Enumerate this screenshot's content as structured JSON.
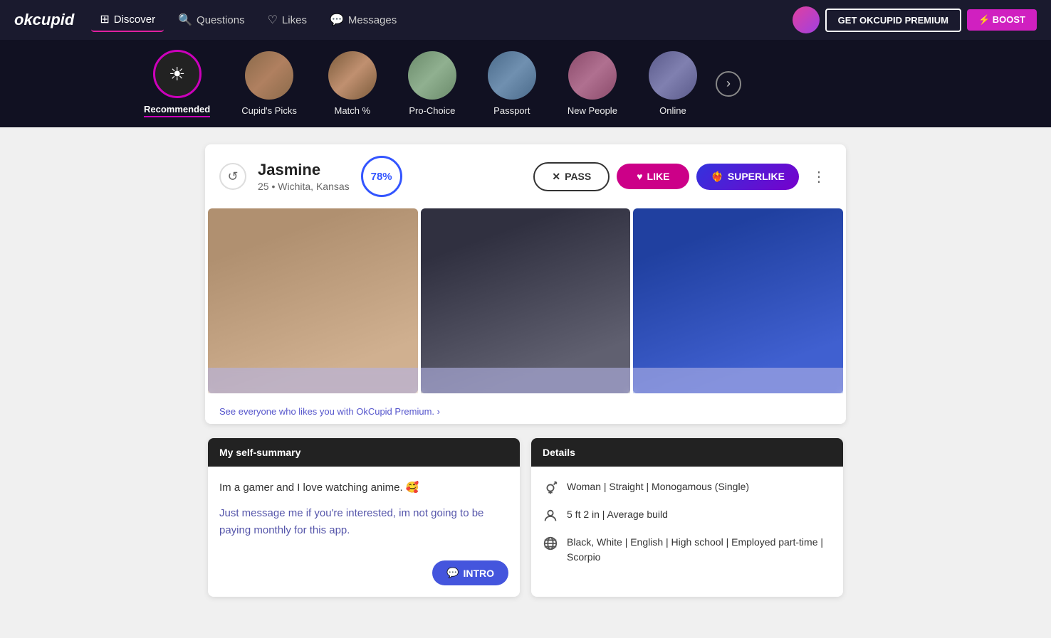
{
  "app": {
    "logo": "okcupid",
    "nav_items": [
      {
        "label": "Discover",
        "icon": "🔲",
        "active": true
      },
      {
        "label": "Questions",
        "icon": "🔍"
      },
      {
        "label": "Likes",
        "icon": "♡"
      },
      {
        "label": "Messages",
        "icon": "💬"
      }
    ],
    "btn_premium": "GET OKCUPID PREMIUM",
    "btn_boost": "⚡ BOOST"
  },
  "categories": [
    {
      "id": "recommended",
      "label": "Recommended",
      "active": true,
      "special": true
    },
    {
      "id": "cupids-picks",
      "label": "Cupid's Picks",
      "active": false
    },
    {
      "id": "match",
      "label": "Match %",
      "active": false
    },
    {
      "id": "pro-choice",
      "label": "Pro-Choice",
      "active": false
    },
    {
      "id": "passport",
      "label": "Passport",
      "active": false
    },
    {
      "id": "new-people",
      "label": "New People",
      "active": false
    },
    {
      "id": "online",
      "label": "Online",
      "active": false
    }
  ],
  "profile": {
    "name": "Jasmine",
    "age": "25",
    "location": "Wichita, Kansas",
    "match_pct": "78%",
    "actions": {
      "pass": "PASS",
      "like": "LIKE",
      "superlike": "SUPERLIKE"
    },
    "premium_link": "See everyone who likes you with OkCupid Premium. ›",
    "self_summary_header": "My self-summary",
    "self_summary_p1": "Im a gamer and I love watching anime. 🥰",
    "self_summary_p2": "Just message me if you're interested, im not going to be paying monthly for this app.",
    "intro_btn": "INTRO",
    "details_header": "Details",
    "details": [
      {
        "icon": "gender",
        "text": "Woman | Straight | Monogamous (Single)"
      },
      {
        "icon": "height",
        "text": "5 ft 2 in | Average build"
      },
      {
        "icon": "globe",
        "text": "Black, White | English | High school | Employed part-time | Scorpio"
      }
    ]
  }
}
